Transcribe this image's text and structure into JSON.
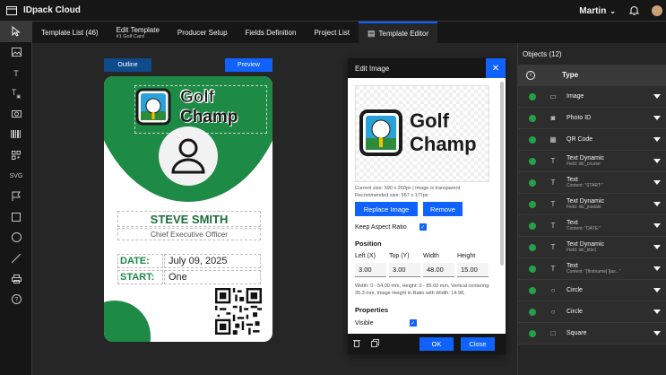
{
  "app": {
    "title": "IDpack Cloud",
    "user": "Martin"
  },
  "nav": {
    "tabs": [
      {
        "label": "Template List (46)"
      },
      {
        "label": "Edit Template",
        "sub": "#1 Golf Card"
      },
      {
        "label": "Producer Setup"
      },
      {
        "label": "Fields Definition"
      },
      {
        "label": "Project List"
      },
      {
        "label": "Template Editor"
      }
    ]
  },
  "tools": [
    {
      "icon": "pointer-icon"
    },
    {
      "icon": "image-icon"
    },
    {
      "icon": "text-icon",
      "glyph": "T"
    },
    {
      "icon": "text-dynamic-icon",
      "glyph": "T"
    },
    {
      "icon": "camera-icon"
    },
    {
      "icon": "barcode-icon"
    },
    {
      "icon": "qr-code-icon"
    },
    {
      "icon": "svg-icon",
      "glyph": "SVG"
    },
    {
      "icon": "flag-icon"
    },
    {
      "icon": "square-icon"
    },
    {
      "icon": "circle-icon"
    },
    {
      "icon": "line-icon"
    },
    {
      "icon": "print-icon"
    },
    {
      "icon": "help-icon"
    }
  ],
  "canvas": {
    "outline_label": "Outline",
    "preview_label": "Preview",
    "card": {
      "logo_line1": "Golf",
      "logo_line2": "Champ",
      "name": "STEVE SMITH",
      "title": "Chief Executive Officer",
      "date_label": "DATE:",
      "date_value": "July 09, 2025",
      "start_label": "START:",
      "start_value": "One"
    }
  },
  "dialog": {
    "title": "Edit Image",
    "logo_line1": "Golf",
    "logo_line2": "Champ",
    "current_size": "Current size: 590 x 260px | Image is transparent",
    "recommended_size": "Recommended size: 567 x 177px",
    "replace_label": "Replace Image",
    "remove_label": "Remove",
    "keep_aspect_label": "Keep Aspect Ratio",
    "position_heading": "Position",
    "left_label": "Left (X)",
    "top_label": "Top (Y)",
    "width_label": "Width",
    "height_label": "Height",
    "left_value": "3.00",
    "top_value": "3.00",
    "width_value": "48.00",
    "height_value": "15.00",
    "note": "Width: 0 - 54.00 mm, Height: 0 - 85.60 mm, Vertical centering: 35.3 mm, Image Height in Ratio with Width: 14.98,",
    "properties_heading": "Properties",
    "visible_label": "Visible",
    "ok_label": "OK",
    "close_label": "Close"
  },
  "objects": {
    "title": "Objects (12)",
    "type_header": "Type",
    "rows": [
      {
        "icon": "image-icon",
        "glyph": "▭",
        "type": "Image",
        "sub": ""
      },
      {
        "icon": "camera-icon",
        "glyph": "◙",
        "type": "Photo ID",
        "sub": ""
      },
      {
        "icon": "qr-code-icon",
        "glyph": "▦",
        "type": "QR Code",
        "sub": ""
      },
      {
        "icon": "text-dynamic-icon",
        "glyph": "T",
        "type": "Text Dynamic",
        "sub": "Field: idc_course"
      },
      {
        "icon": "text-icon",
        "glyph": "T",
        "type": "Text",
        "sub": "Content: \"START:\""
      },
      {
        "icon": "text-dynamic-icon",
        "glyph": "T",
        "type": "Text Dynamic",
        "sub": "Field: idc_jnsdate"
      },
      {
        "icon": "text-icon",
        "glyph": "T",
        "type": "Text",
        "sub": "Content: \"DATE:\""
      },
      {
        "icon": "text-dynamic-icon",
        "glyph": "T",
        "type": "Text Dynamic",
        "sub": "Field: idc_title1"
      },
      {
        "icon": "text-icon",
        "glyph": "T",
        "type": "Text",
        "sub": "Content: \"[firstname] [las...\""
      },
      {
        "icon": "circle-icon",
        "glyph": "○",
        "type": "Circle",
        "sub": ""
      },
      {
        "icon": "circle-icon",
        "glyph": "○",
        "type": "Circle",
        "sub": ""
      },
      {
        "icon": "square-icon",
        "glyph": "□",
        "type": "Square",
        "sub": ""
      }
    ]
  },
  "colors": {
    "accent": "#0f62fe",
    "card_green": "#1d8a46",
    "status_green": "#24a148"
  }
}
